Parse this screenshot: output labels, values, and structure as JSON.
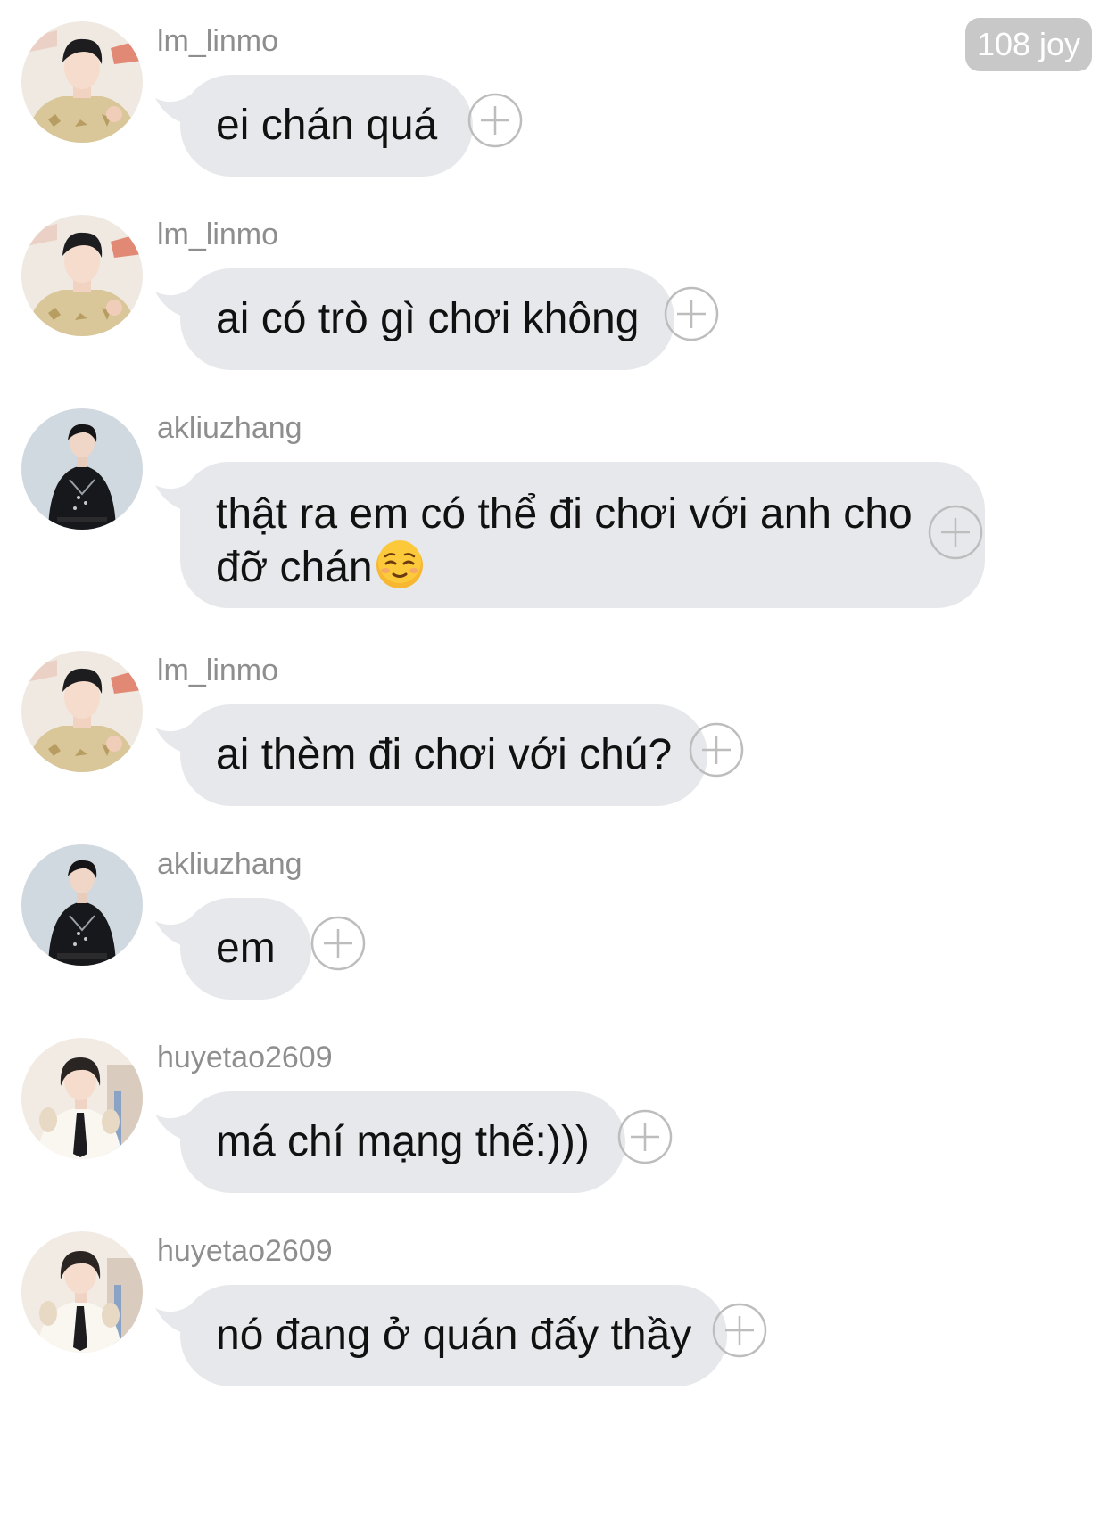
{
  "header": {
    "joy_badge": "108 joy"
  },
  "messages": [
    {
      "username": "lm_linmo",
      "avatar": "avatar-lm-linmo",
      "text": "ei chán quá"
    },
    {
      "username": "lm_linmo",
      "avatar": "avatar-lm-linmo",
      "text": "ai có trò gì chơi không"
    },
    {
      "username": "akliuzhang",
      "avatar": "avatar-akliuzhang",
      "text_line1": "thật ra em có thể đi chơi với anh cho",
      "text_line2": "đỡ chán",
      "emoji": "relieved-face-emoji"
    },
    {
      "username": "lm_linmo",
      "avatar": "avatar-lm-linmo",
      "text": "ai thèm đi chơi với chú?"
    },
    {
      "username": "akliuzhang",
      "avatar": "avatar-akliuzhang",
      "text": "em"
    },
    {
      "username": "huyetao2609",
      "avatar": "avatar-huyetao2609",
      "text": "má chí mạng thế:)))"
    },
    {
      "username": "huyetao2609",
      "avatar": "avatar-huyetao2609",
      "text": "nó đang ở quán đấy thầy"
    }
  ],
  "colors": {
    "bubble": "#e6e8eb",
    "username": "#8e8e8e",
    "badge_bg": "#c8c8c8",
    "plus_icon": "#bdbdbd"
  },
  "icons": {
    "add_reaction": "plus-circle-icon"
  }
}
